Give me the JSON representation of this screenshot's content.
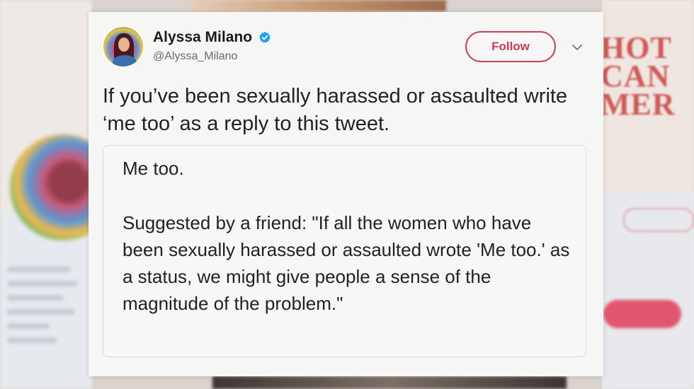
{
  "tweet": {
    "author_name": "Alyssa Milano",
    "author_handle": "@Alyssa_Milano",
    "follow_label": "Follow",
    "text": "If you’ve been sexually harassed or assaulted write ‘me too’ as a reply to this tweet.",
    "quote": {
      "line1": "Me too.",
      "line2": "Suggested by a friend: \"If all the women who have been sexually harassed or assaulted wrote 'Me too.' as a status, we might give people a sense of the magnitude of the problem.\""
    },
    "icons": {
      "verified": "verified-badge-icon",
      "more": "chevron-down-icon"
    }
  },
  "background": {
    "headline_fragment": "HOT\nCAN\nMER"
  },
  "colors": {
    "follow_accent": "#c63e55",
    "verified_blue": "#1da1f2",
    "card_bg": "#f6f6f5"
  }
}
